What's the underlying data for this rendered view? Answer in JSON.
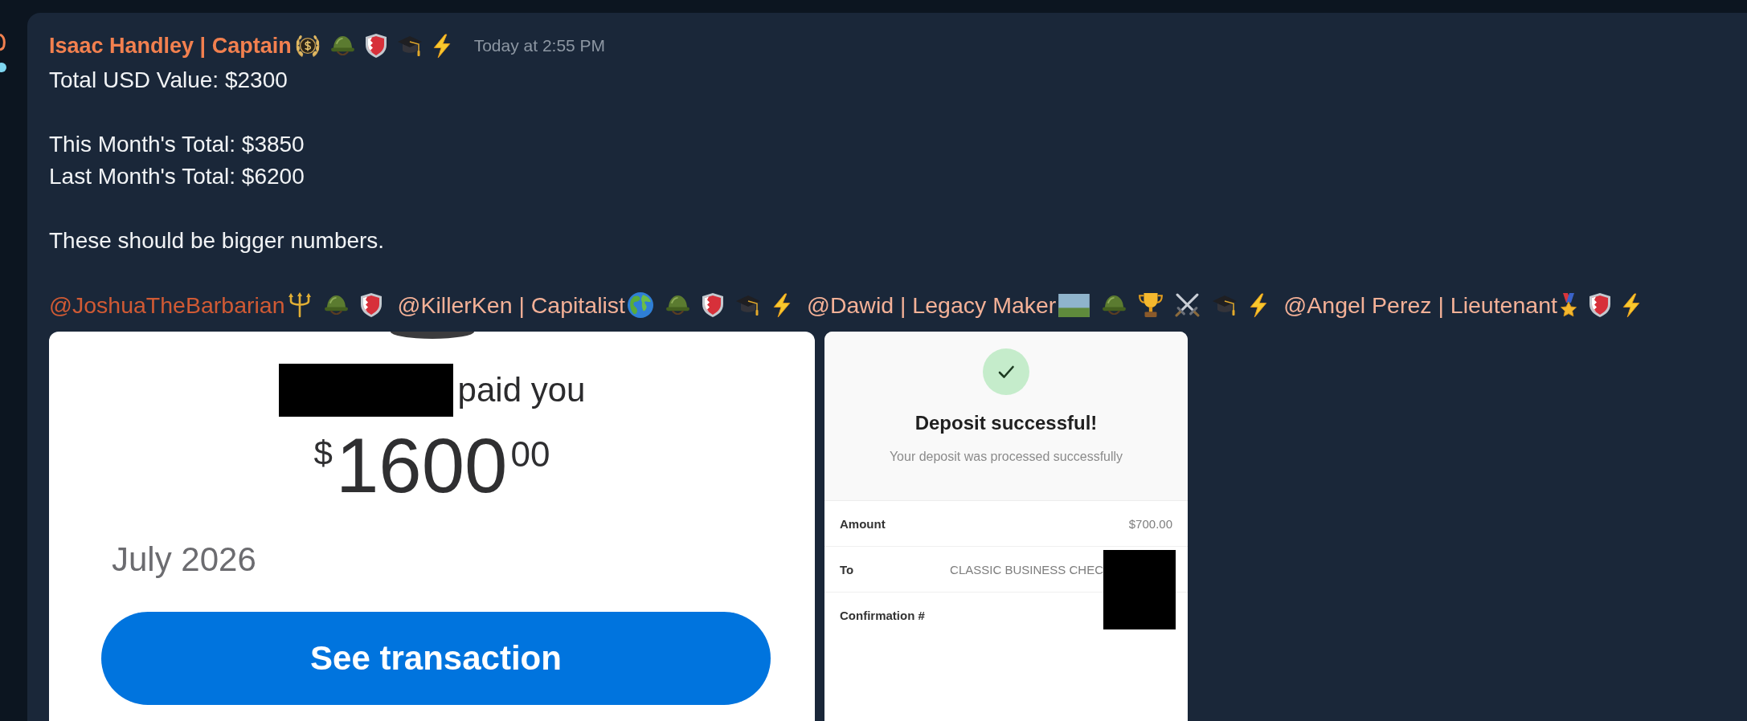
{
  "message": {
    "author": {
      "name": "Isaac Handley | Captain",
      "badges": [
        {
          "kind": "wreath"
        },
        {
          "kind": "helmet"
        },
        {
          "kind": "shield"
        },
        {
          "kind": "cap"
        },
        {
          "kind": "bolt"
        }
      ]
    },
    "timestamp": "Today at 2:55 PM",
    "paragraphs": [
      {
        "lines": [
          "Total USD Value: $2300"
        ]
      },
      {
        "lines": [
          "This Month's Total: $3850",
          "Last Month's Total: $6200"
        ]
      },
      {
        "lines": [
          "These should be bigger numbers."
        ]
      }
    ],
    "mentions": [
      {
        "text": "@JoshuaTheBarbarian",
        "color": "#d05a34",
        "badges": [
          {
            "kind": "trident"
          },
          {
            "kind": "helmet"
          },
          {
            "kind": "shield"
          }
        ]
      },
      {
        "text": "@KillerKen | Capitalist",
        "color": "#f4b197",
        "badges": [
          {
            "kind": "globe"
          },
          {
            "kind": "helmet"
          },
          {
            "kind": "shield"
          },
          {
            "kind": "cap"
          },
          {
            "kind": "bolt"
          }
        ]
      },
      {
        "text": "@Dawid | Legacy Maker",
        "color": "#f4b197",
        "badges": [
          {
            "kind": "photo"
          },
          {
            "kind": "helmet"
          },
          {
            "kind": "trophy"
          },
          {
            "kind": "swords"
          },
          {
            "kind": "cap"
          },
          {
            "kind": "bolt"
          }
        ]
      },
      {
        "text": "@Angel Perez | Lieutenant",
        "color": "#f4b197",
        "badges": [
          {
            "kind": "medal"
          },
          {
            "kind": "shield"
          },
          {
            "kind": "bolt"
          }
        ]
      }
    ],
    "attachments": [
      {
        "kind": "payment",
        "payer_redacted": true,
        "status": "paid you",
        "amount": {
          "currency": "$",
          "whole": "1600",
          "cents": "00"
        },
        "date": "July 2026",
        "button": "See transaction"
      },
      {
        "kind": "deposit",
        "title": "Deposit successful!",
        "subtitle": "Your deposit was processed successfully",
        "rows": [
          {
            "label": "Amount",
            "value": "$700.00",
            "redacted": false
          },
          {
            "label": "To",
            "value": "CLASSIC BUSINESS CHEC",
            "redacted": true
          },
          {
            "label": "Confirmation #",
            "redacted": true
          }
        ]
      }
    ]
  }
}
